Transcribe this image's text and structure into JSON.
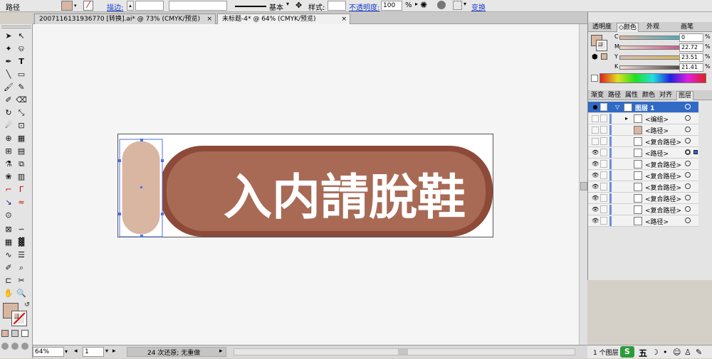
{
  "control_bar": {
    "object_type": "路径",
    "stroke_label": "描边:",
    "stroke_profile": "基本",
    "style_label": "样式:",
    "opacity_label": "不透明度:",
    "opacity_value": "100",
    "opacity_unit": "%",
    "transform_label": "变换"
  },
  "doc_tabs": [
    {
      "label": "20071161319367​70 [转换].ai* @ 73% (CMYK/预览)",
      "active": false
    },
    {
      "label": "未标题-4* @ 64% (CMYK/预览)",
      "active": true
    }
  ],
  "artwork": {
    "sign_text": "入内請脫鞋",
    "outer_color": "#8d4a38",
    "inner_color": "#a86a55",
    "pill_color": "#d9b6a1",
    "text_color": "#ffffff"
  },
  "status_bar": {
    "zoom": "64%",
    "page": "1",
    "message": "24 次还原; 无重做"
  },
  "color_panel": {
    "tabs": [
      "透明度",
      "颜色",
      "外观",
      "画笔"
    ],
    "active_tab": "颜色",
    "channels": [
      {
        "label": "C",
        "value": "0",
        "unit": "%"
      },
      {
        "label": "M",
        "value": "22.72",
        "unit": "%"
      },
      {
        "label": "Y",
        "value": "23.51",
        "unit": "%"
      },
      {
        "label": "K",
        "value": "21.41",
        "unit": "%"
      }
    ],
    "fill_color": "#d9b6a1"
  },
  "layers_panel": {
    "tabs": [
      "渐变",
      "路径",
      "属性",
      "颜色",
      "对齐",
      "图层"
    ],
    "active_tab": "图层",
    "layer_name": "图层 1",
    "items": [
      {
        "name": "<编组>",
        "eye": false,
        "expand": true
      },
      {
        "name": "<路径>",
        "eye": false,
        "expand": false
      },
      {
        "name": "<复合路径>",
        "eye": false,
        "expand": false
      },
      {
        "name": "<路径>",
        "eye": true,
        "expand": false,
        "selected_target": true
      },
      {
        "name": "<复合路径>",
        "eye": true,
        "expand": false
      },
      {
        "name": "<复合路径>",
        "eye": true,
        "expand": false
      },
      {
        "name": "<复合路径>",
        "eye": true,
        "expand": false
      },
      {
        "name": "<复合路径>",
        "eye": true,
        "expand": false
      },
      {
        "name": "<复合路径>",
        "eye": true,
        "expand": false
      },
      {
        "name": "<路径>",
        "eye": true,
        "expand": false
      }
    ],
    "footer": "1 个图层"
  },
  "taskbar": {
    "ime": "五"
  },
  "colors": {
    "selection_blue": "#316ac5",
    "swatch_fill": "#d9b6a1"
  }
}
